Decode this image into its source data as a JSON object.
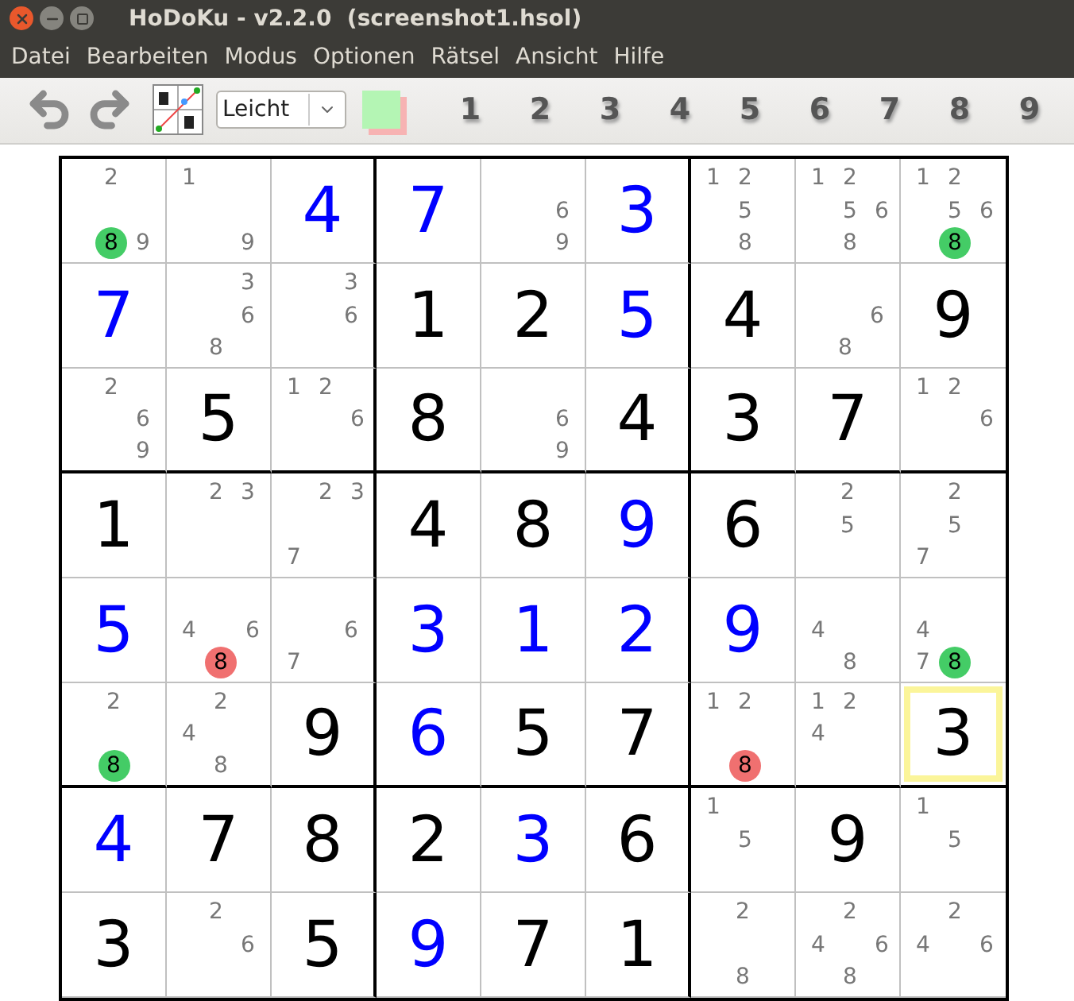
{
  "window": {
    "title": "HoDoKu - v2.2.0  (screenshot1.hsol)"
  },
  "menu": [
    "Datei",
    "Bearbeiten",
    "Modus",
    "Optionen",
    "Rätsel",
    "Ansicht",
    "Hilfe"
  ],
  "toolbar": {
    "level": "Leicht",
    "color_button": {
      "color": "#b4f5b4"
    },
    "digits": [
      "1",
      "2",
      "3",
      "4",
      "5",
      "6",
      "7",
      "8",
      "9"
    ]
  },
  "board": {
    "rows": [
      [
        {
          "kind": "candidates",
          "selected": false,
          "candidates": [
            {
              "digit": "2"
            },
            {
              "digit": "8",
              "color": "#44cc66"
            },
            {
              "digit": "9"
            }
          ]
        },
        {
          "kind": "candidates",
          "selected": false,
          "candidates": [
            {
              "digit": "1"
            },
            {
              "digit": "9"
            }
          ]
        },
        {
          "kind": "solved",
          "selected": false,
          "value": "4"
        },
        {
          "kind": "solved",
          "selected": false,
          "value": "7"
        },
        {
          "kind": "candidates",
          "selected": false,
          "candidates": [
            {
              "digit": "6"
            },
            {
              "digit": "9"
            }
          ]
        },
        {
          "kind": "solved",
          "selected": false,
          "value": "3"
        },
        {
          "kind": "candidates",
          "selected": false,
          "candidates": [
            {
              "digit": "1"
            },
            {
              "digit": "2"
            },
            {
              "digit": "5"
            },
            {
              "digit": "8"
            }
          ]
        },
        {
          "kind": "candidates",
          "selected": false,
          "candidates": [
            {
              "digit": "1"
            },
            {
              "digit": "2"
            },
            {
              "digit": "5"
            },
            {
              "digit": "6"
            },
            {
              "digit": "8"
            }
          ]
        },
        {
          "kind": "candidates",
          "selected": false,
          "candidates": [
            {
              "digit": "1"
            },
            {
              "digit": "2"
            },
            {
              "digit": "5"
            },
            {
              "digit": "6"
            },
            {
              "digit": "8",
              "color": "#44cc66"
            }
          ]
        }
      ],
      [
        {
          "kind": "solved",
          "selected": false,
          "value": "7"
        },
        {
          "kind": "candidates",
          "selected": false,
          "candidates": [
            {
              "digit": "3"
            },
            {
              "digit": "6"
            },
            {
              "digit": "8"
            }
          ]
        },
        {
          "kind": "candidates",
          "selected": false,
          "candidates": [
            {
              "digit": "3"
            },
            {
              "digit": "6"
            }
          ]
        },
        {
          "kind": "given",
          "selected": false,
          "value": "1"
        },
        {
          "kind": "given",
          "selected": false,
          "value": "2"
        },
        {
          "kind": "solved",
          "selected": false,
          "value": "5"
        },
        {
          "kind": "given",
          "selected": false,
          "value": "4"
        },
        {
          "kind": "candidates",
          "selected": false,
          "candidates": [
            {
              "digit": "6"
            },
            {
              "digit": "8"
            }
          ]
        },
        {
          "kind": "given",
          "selected": false,
          "value": "9"
        }
      ],
      [
        {
          "kind": "candidates",
          "selected": false,
          "candidates": [
            {
              "digit": "2"
            },
            {
              "digit": "6"
            },
            {
              "digit": "9"
            }
          ]
        },
        {
          "kind": "given",
          "selected": false,
          "value": "5"
        },
        {
          "kind": "candidates",
          "selected": false,
          "candidates": [
            {
              "digit": "1"
            },
            {
              "digit": "2"
            },
            {
              "digit": "6"
            }
          ]
        },
        {
          "kind": "given",
          "selected": false,
          "value": "8"
        },
        {
          "kind": "candidates",
          "selected": false,
          "candidates": [
            {
              "digit": "6"
            },
            {
              "digit": "9"
            }
          ]
        },
        {
          "kind": "given",
          "selected": false,
          "value": "4"
        },
        {
          "kind": "given",
          "selected": false,
          "value": "3"
        },
        {
          "kind": "given",
          "selected": false,
          "value": "7"
        },
        {
          "kind": "candidates",
          "selected": false,
          "candidates": [
            {
              "digit": "1"
            },
            {
              "digit": "2"
            },
            {
              "digit": "6"
            }
          ]
        }
      ],
      [
        {
          "kind": "given",
          "selected": false,
          "value": "1"
        },
        {
          "kind": "candidates",
          "selected": false,
          "candidates": [
            {
              "digit": "2"
            },
            {
              "digit": "3"
            }
          ]
        },
        {
          "kind": "candidates",
          "selected": false,
          "candidates": [
            {
              "digit": "2"
            },
            {
              "digit": "3"
            },
            {
              "digit": "7"
            }
          ]
        },
        {
          "kind": "given",
          "selected": false,
          "value": "4"
        },
        {
          "kind": "given",
          "selected": false,
          "value": "8"
        },
        {
          "kind": "solved",
          "selected": false,
          "value": "9"
        },
        {
          "kind": "given",
          "selected": false,
          "value": "6"
        },
        {
          "kind": "candidates",
          "selected": false,
          "candidates": [
            {
              "digit": "2"
            },
            {
              "digit": "5"
            }
          ]
        },
        {
          "kind": "candidates",
          "selected": false,
          "candidates": [
            {
              "digit": "2"
            },
            {
              "digit": "5"
            },
            {
              "digit": "7"
            }
          ]
        }
      ],
      [
        {
          "kind": "solved",
          "selected": false,
          "value": "5"
        },
        {
          "kind": "candidates",
          "selected": false,
          "candidates": [
            {
              "digit": "4"
            },
            {
              "digit": "6"
            },
            {
              "digit": "8",
              "color": "#f07070"
            }
          ]
        },
        {
          "kind": "candidates",
          "selected": false,
          "candidates": [
            {
              "digit": "6"
            },
            {
              "digit": "7"
            }
          ]
        },
        {
          "kind": "solved",
          "selected": false,
          "value": "3"
        },
        {
          "kind": "solved",
          "selected": false,
          "value": "1"
        },
        {
          "kind": "solved",
          "selected": false,
          "value": "2"
        },
        {
          "kind": "solved",
          "selected": false,
          "value": "9"
        },
        {
          "kind": "candidates",
          "selected": false,
          "candidates": [
            {
              "digit": "4"
            },
            {
              "digit": "8"
            }
          ]
        },
        {
          "kind": "candidates",
          "selected": false,
          "candidates": [
            {
              "digit": "4"
            },
            {
              "digit": "7"
            },
            {
              "digit": "8",
              "color": "#44cc66"
            }
          ]
        }
      ],
      [
        {
          "kind": "candidates",
          "selected": false,
          "candidates": [
            {
              "digit": "2"
            },
            {
              "digit": "8",
              "color": "#44cc66"
            }
          ]
        },
        {
          "kind": "candidates",
          "selected": false,
          "candidates": [
            {
              "digit": "2"
            },
            {
              "digit": "4"
            },
            {
              "digit": "8"
            }
          ]
        },
        {
          "kind": "given",
          "selected": false,
          "value": "9"
        },
        {
          "kind": "solved",
          "selected": false,
          "value": "6"
        },
        {
          "kind": "given",
          "selected": false,
          "value": "5"
        },
        {
          "kind": "given",
          "selected": false,
          "value": "7"
        },
        {
          "kind": "candidates",
          "selected": false,
          "candidates": [
            {
              "digit": "1"
            },
            {
              "digit": "2"
            },
            {
              "digit": "8",
              "color": "#f07070"
            }
          ]
        },
        {
          "kind": "candidates",
          "selected": false,
          "candidates": [
            {
              "digit": "1"
            },
            {
              "digit": "2"
            },
            {
              "digit": "4"
            }
          ]
        },
        {
          "kind": "given",
          "selected": true,
          "value": "3"
        }
      ],
      [
        {
          "kind": "solved",
          "selected": false,
          "value": "4"
        },
        {
          "kind": "given",
          "selected": false,
          "value": "7"
        },
        {
          "kind": "given",
          "selected": false,
          "value": "8"
        },
        {
          "kind": "given",
          "selected": false,
          "value": "2"
        },
        {
          "kind": "solved",
          "selected": false,
          "value": "3"
        },
        {
          "kind": "given",
          "selected": false,
          "value": "6"
        },
        {
          "kind": "candidates",
          "selected": false,
          "candidates": [
            {
              "digit": "1"
            },
            {
              "digit": "5"
            }
          ]
        },
        {
          "kind": "given",
          "selected": false,
          "value": "9"
        },
        {
          "kind": "candidates",
          "selected": false,
          "candidates": [
            {
              "digit": "1"
            },
            {
              "digit": "5"
            }
          ]
        }
      ],
      [
        {
          "kind": "given",
          "selected": false,
          "value": "3"
        },
        {
          "kind": "candidates",
          "selected": false,
          "candidates": [
            {
              "digit": "2"
            },
            {
              "digit": "6"
            }
          ]
        },
        {
          "kind": "given",
          "selected": false,
          "value": "5"
        },
        {
          "kind": "solved",
          "selected": false,
          "value": "9"
        },
        {
          "kind": "given",
          "selected": false,
          "value": "7"
        },
        {
          "kind": "given",
          "selected": false,
          "value": "1"
        },
        {
          "kind": "candidates",
          "selected": false,
          "candidates": [
            {
              "digit": "2"
            },
            {
              "digit": "8"
            }
          ]
        },
        {
          "kind": "candidates",
          "selected": false,
          "candidates": [
            {
              "digit": "2"
            },
            {
              "digit": "4"
            },
            {
              "digit": "6"
            },
            {
              "digit": "8"
            }
          ]
        },
        {
          "kind": "candidates",
          "selected": false,
          "candidates": [
            {
              "digit": "2"
            },
            {
              "digit": "4"
            },
            {
              "digit": "6"
            }
          ]
        }
      ]
    ]
  }
}
